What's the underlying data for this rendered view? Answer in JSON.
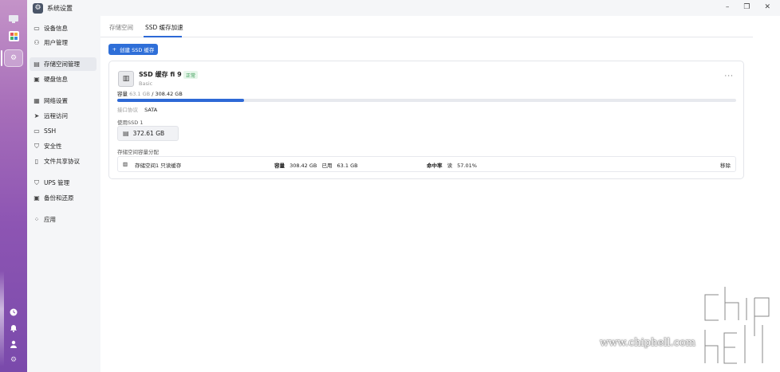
{
  "window": {
    "title": "系统设置"
  },
  "sidebar": {
    "items": [
      {
        "label": "设备信息",
        "icon": "monitor-icon"
      },
      {
        "label": "用户管理",
        "icon": "user-icon"
      },
      {
        "label": "存储空间管理",
        "icon": "storage-icon",
        "active": true
      },
      {
        "label": "硬盘信息",
        "icon": "disk-icon"
      },
      {
        "label": "网络设置",
        "icon": "network-icon"
      },
      {
        "label": "远程访问",
        "icon": "send-icon"
      },
      {
        "label": "SSH",
        "icon": "terminal-icon"
      },
      {
        "label": "安全性",
        "icon": "shield-icon"
      },
      {
        "label": "文件共享协议",
        "icon": "file-icon"
      },
      {
        "label": "UPS 管理",
        "icon": "power-icon"
      },
      {
        "label": "备份和还原",
        "icon": "backup-icon"
      },
      {
        "label": "应用",
        "icon": "apps-icon"
      }
    ]
  },
  "tabs": [
    {
      "label": "存储空间"
    },
    {
      "label": "SSD 缓存加速",
      "active": true
    }
  ],
  "toolbar": {
    "create_label": "创建 SSD 缓存"
  },
  "cache": {
    "name": "SSD 缓存 fi   9",
    "status": "正常",
    "type": "Basic",
    "capacity_label": "容量",
    "used": "63.1 GB",
    "separator": "/",
    "total": "308.42 GB",
    "usage_fraction": 0.2046,
    "protocol_label": "接口协议",
    "protocol": "SATA",
    "used_ssd_label": "使用SSD 1",
    "ssd_size": "372.61 GB",
    "alloc_label": "存储空间容量分配",
    "alloc": {
      "volume": "存储空间1 只读缓存",
      "cap_label": "容量",
      "cap_value": "308.42 GB",
      "used_label": "已用",
      "used_value": "63.1 GB",
      "hit_label": "命中率",
      "hit_mode": "读",
      "hit_value": "57.01%",
      "remove_label": "移除"
    }
  },
  "watermark": {
    "text": "www.chiphell.com"
  }
}
